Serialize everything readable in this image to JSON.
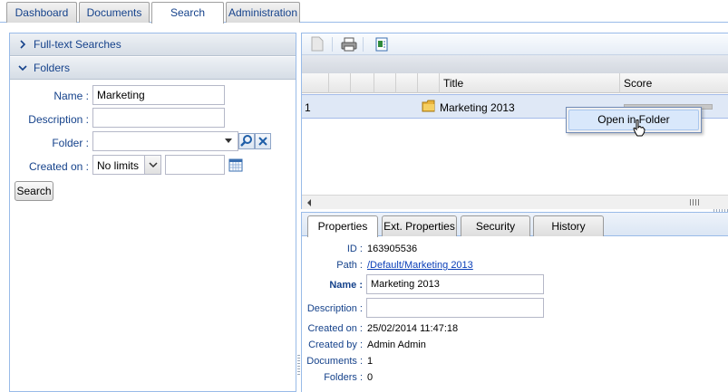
{
  "top_tabs": [
    {
      "label": "Dashboard"
    },
    {
      "label": "Documents"
    },
    {
      "label": "Search"
    },
    {
      "label": "Administration"
    }
  ],
  "left_panel": {
    "fulltext_header": "Full-text Searches",
    "folders_header": "Folders",
    "form": {
      "name_label": "Name :",
      "name_value": "Marketing",
      "description_label": "Description :",
      "description_value": "",
      "folder_label": "Folder :",
      "folder_value": "",
      "created_label": "Created on :",
      "created_select": "No limits",
      "created_date": ""
    },
    "search_button": "Search"
  },
  "results": {
    "columns": [
      "Title",
      "Score"
    ],
    "rows": [
      {
        "index": "1",
        "title": "Marketing 2013",
        "icon": "folder-icon",
        "score": 1.0
      }
    ],
    "context_menu": {
      "item": "Open in Folder"
    }
  },
  "properties": {
    "tabs": [
      {
        "label": "Properties"
      },
      {
        "label": "Ext. Properties"
      },
      {
        "label": "Security"
      },
      {
        "label": "History"
      }
    ],
    "fields": {
      "id_label": "ID :",
      "id_value": "163905536",
      "path_label": "Path :",
      "path_value": "/Default/Marketing 2013",
      "name_label": "Name :",
      "name_value": "Marketing 2013",
      "description_label": "Description :",
      "description_value": "",
      "created_label": "Created on :",
      "created_value": "25/02/2014 11:47:18",
      "created_by_label": "Created by :",
      "created_by_value": "Admin Admin",
      "documents_label": "Documents :",
      "documents_value": "1",
      "folders_label": "Folders :",
      "folders_value": "0"
    }
  },
  "colors": {
    "accent": "#15428b",
    "panel_border": "#99bbe8",
    "selected_row": "#dfe8f6",
    "link": "#0b3fb8"
  }
}
